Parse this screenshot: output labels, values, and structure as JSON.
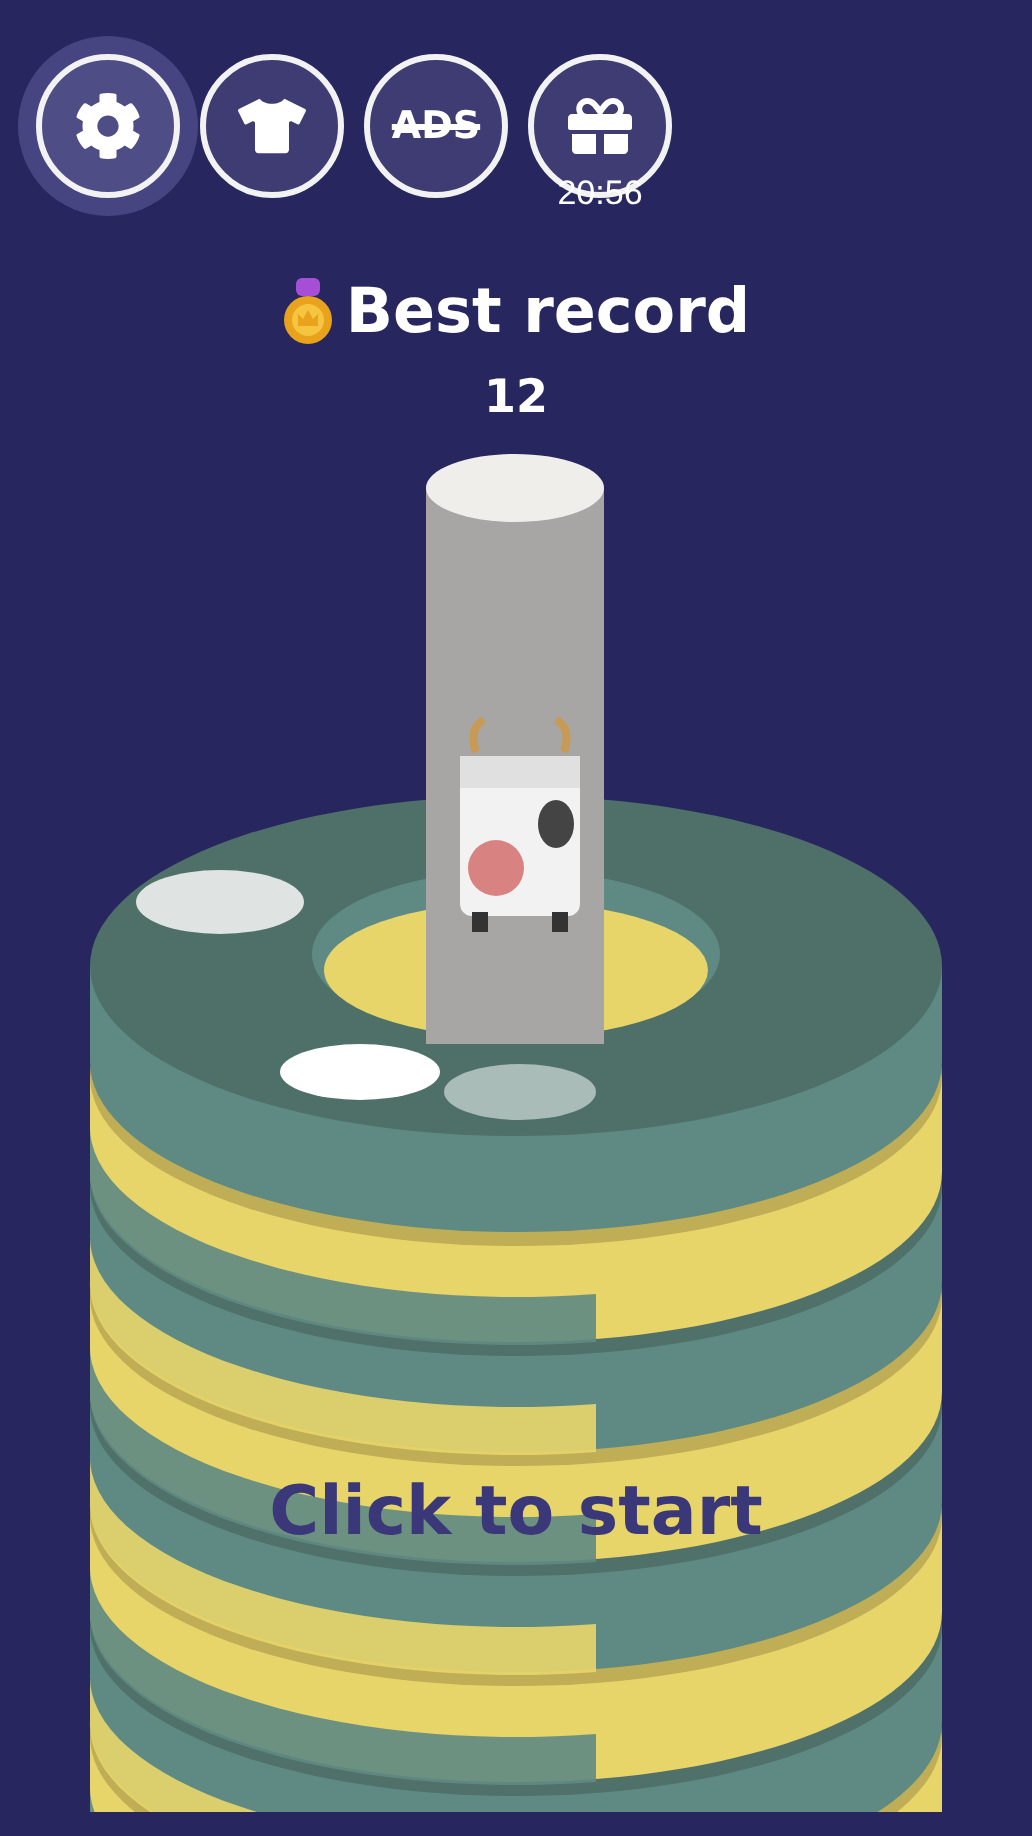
{
  "toolbar": [
    {
      "kind": "settings",
      "selected": true
    },
    {
      "kind": "shop",
      "selected": false
    },
    {
      "kind": "no_ads",
      "label": "ADS",
      "selected": false
    },
    {
      "kind": "gift",
      "timer": "20:56",
      "selected": false
    }
  ],
  "best_record": {
    "title": "Best record",
    "value": "12"
  },
  "prompt": "Click to start"
}
